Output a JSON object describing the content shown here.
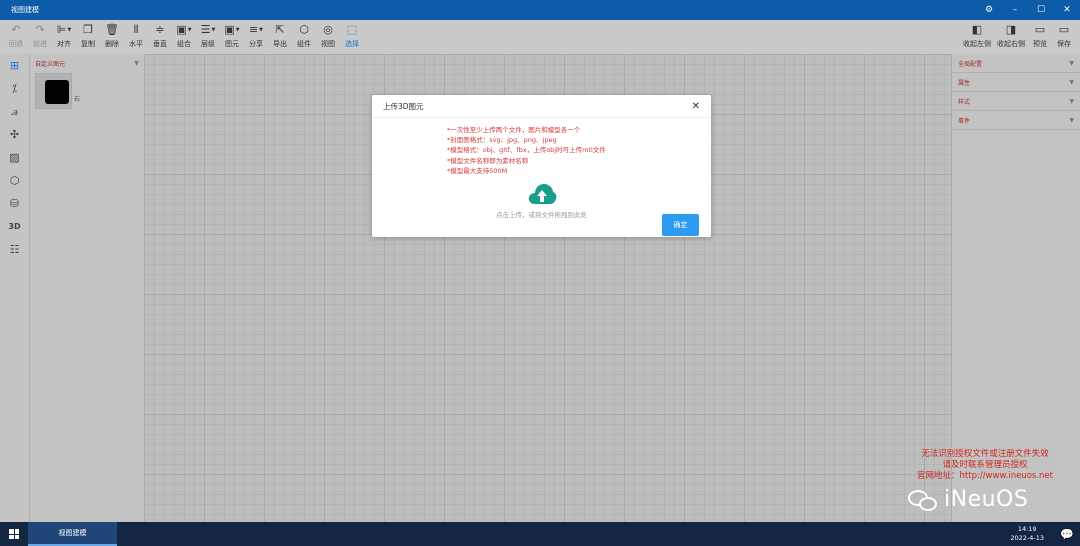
{
  "window": {
    "title": "视图建模"
  },
  "toolbar": {
    "left": [
      {
        "label": "回退",
        "icon": "undo-icon",
        "glyph": "↶",
        "state": "disabled"
      },
      {
        "label": "前进",
        "icon": "redo-icon",
        "glyph": "↷",
        "state": "disabled"
      },
      {
        "label": "对齐",
        "icon": "align-icon",
        "glyph": "⊫",
        "state": "normal",
        "dropdown": true
      },
      {
        "label": "复制",
        "icon": "copy-icon",
        "glyph": "❐",
        "state": "normal"
      },
      {
        "label": "删除",
        "icon": "trash-icon",
        "glyph": "🗑",
        "state": "normal"
      },
      {
        "label": "水平",
        "icon": "horizontal-icon",
        "glyph": "⫴",
        "state": "normal"
      },
      {
        "label": "垂直",
        "icon": "vertical-icon",
        "glyph": "≑",
        "state": "normal"
      },
      {
        "label": "组合",
        "icon": "group-icon",
        "glyph": "▣",
        "state": "normal",
        "dropdown": true
      },
      {
        "label": "层级",
        "icon": "layer-icon",
        "glyph": "☰",
        "state": "normal",
        "dropdown": true
      },
      {
        "label": "图元",
        "icon": "element-icon",
        "glyph": "▣",
        "state": "normal",
        "dropdown": true
      },
      {
        "label": "分享",
        "icon": "share-icon",
        "glyph": "≡",
        "state": "normal",
        "dropdown": true
      },
      {
        "label": "导出",
        "icon": "export-icon",
        "glyph": "⇱",
        "state": "normal"
      },
      {
        "label": "组件",
        "icon": "component-icon",
        "glyph": "⬡",
        "state": "normal"
      },
      {
        "label": "视图",
        "icon": "view-icon",
        "glyph": "◎",
        "state": "normal"
      },
      {
        "label": "选择",
        "icon": "select-icon",
        "glyph": "⬚",
        "state": "active"
      }
    ],
    "right": [
      {
        "label": "收起左侧",
        "icon": "collapse-left-icon",
        "glyph": "◧"
      },
      {
        "label": "收起右侧",
        "icon": "collapse-right-icon",
        "glyph": "◨"
      },
      {
        "label": "预览",
        "icon": "preview-icon",
        "glyph": "▭"
      },
      {
        "label": "保存",
        "icon": "save-icon",
        "glyph": "▭"
      }
    ]
  },
  "iconbar": [
    {
      "icon": "layout-icon",
      "glyph": "⊞",
      "active": true
    },
    {
      "icon": "magic-icon",
      "glyph": "⁒",
      "active": false
    },
    {
      "icon": "text-shapes-icon",
      "glyph": "ꭿ",
      "active": false
    },
    {
      "icon": "puzzle-icon",
      "glyph": "✣",
      "active": false
    },
    {
      "icon": "image-icon",
      "glyph": "▨",
      "active": false
    },
    {
      "icon": "cube-icon",
      "glyph": "⬡",
      "active": false
    },
    {
      "icon": "database-icon",
      "glyph": "⛁",
      "active": false
    },
    {
      "icon": "3d-icon",
      "glyph": "3D",
      "active": false
    },
    {
      "icon": "list-icon",
      "glyph": "☷",
      "active": false
    }
  ],
  "leftpanel": {
    "title": "自定义图元",
    "item_tag": "右"
  },
  "rightpanel": {
    "sections": [
      "全局配置",
      "属性",
      "样式",
      "事件"
    ]
  },
  "dialog": {
    "title": "上传3D图元",
    "tips": [
      "*一次性至少上传两个文件，图片和模型各一个",
      "*封面图格式：svg、jpg、png、jpeg",
      "*模型格式：obj、gltf、fbx，上传obj时可上传mtl文件",
      "*模型文件名称即为素材名称",
      "*模型最大支持500M"
    ],
    "upload_hint": "点击上传，或将文件拖拽到此处",
    "ok_label": "确定",
    "accent_color": "#2d9cf0",
    "icon_color": "#199e8a"
  },
  "watermark": {
    "lines": [
      "无法识别授权文件或注册文件失效",
      "请及时联系管理员授权",
      "官网地址：http://www.ineuos.net"
    ],
    "brand": "iNeuOS"
  },
  "taskbar": {
    "app_label": "视图建模",
    "time": "14:19",
    "date": "2022-4-13"
  }
}
